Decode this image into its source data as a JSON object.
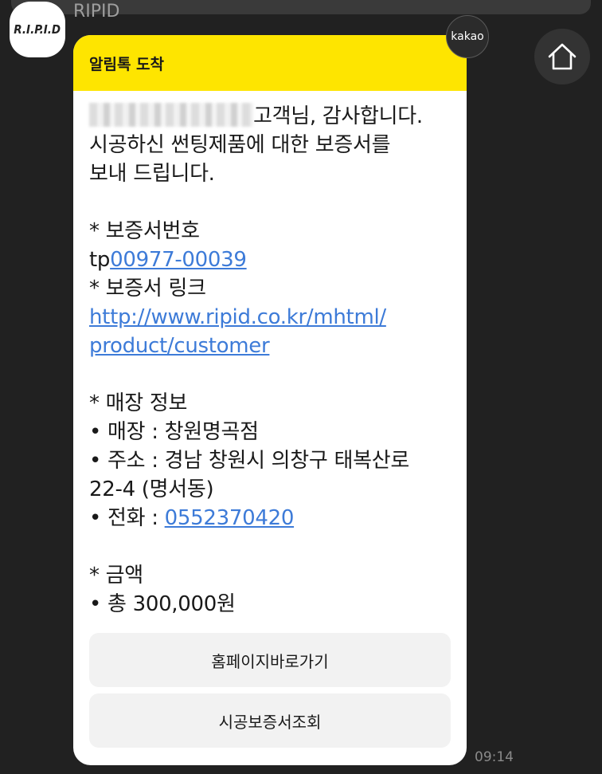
{
  "sender": {
    "name": "RIPID",
    "avatar_logo": "R.I.P.I.D"
  },
  "kakao_badge": "kakao",
  "card": {
    "header_title": "알림톡 도착",
    "lines": {
      "greeting_suffix": "고객님, 감사합니다.",
      "intro_line2": "시공하신 썬팅제품에 대한 보증서를",
      "intro_line3": "보내 드립니다.",
      "warranty_number_label": "* 보증서번호",
      "warranty_number_prefix": "tp",
      "warranty_number_link": "00977-00039",
      "warranty_link_label": "* 보증서 링크",
      "warranty_url_line1": "http://www.ripid.co.kr/mhtml/",
      "warranty_url_line2": "product/customer",
      "store_info_label": "* 매장 정보",
      "store_name": "• 매장 : 창원명곡점",
      "store_address_line1": "• 주소 : 경남 창원시 의창구 태복산로",
      "store_address_line2": "22-4 (명서동)",
      "store_phone_prefix": "• 전화 : ",
      "store_phone_link": "0552370420",
      "amount_label": "* 금액",
      "amount_value": "• 총 300,000원"
    },
    "buttons": {
      "homepage": "홈페이지바로가기",
      "warranty_lookup": "시공보증서조회"
    }
  },
  "timestamp": "09:14",
  "colors": {
    "background": "#212121",
    "header_yellow": "#fee500",
    "link_blue": "#3d7bd8"
  }
}
